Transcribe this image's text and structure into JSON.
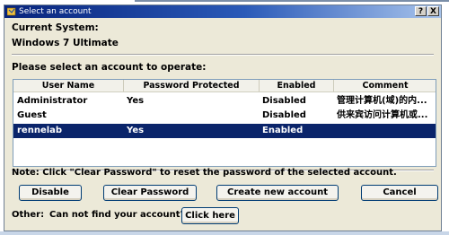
{
  "window": {
    "title": "Select an account",
    "help_btn": "?",
    "close_btn": "X"
  },
  "system": {
    "label": "Current System:",
    "value": "Windows 7 Ultimate"
  },
  "prompt": "Please select an account to operate:",
  "table": {
    "headers": [
      "User Name",
      "Password Protected",
      "Enabled",
      "Comment"
    ],
    "rows": [
      {
        "user": "Administrator",
        "protected": "Yes",
        "enabled": "Disabled",
        "comment": "管理计算机(域)的内..."
      },
      {
        "user": "Guest",
        "protected": "",
        "enabled": "Disabled",
        "comment": "供来宾访问计算机或..."
      },
      {
        "user": "rennelab",
        "protected": "Yes",
        "enabled": "Enabled",
        "comment": ""
      }
    ],
    "selected_row": 2
  },
  "note": "Note: Click \"Clear Password\" to reset the password of the selected account.",
  "buttons": {
    "disable": "Disable",
    "clear_password": "Clear Password",
    "create_new_account": "Create new account",
    "cancel": "Cancel"
  },
  "other": {
    "label": "Other:",
    "question": "Can not find your account?",
    "click_here": "Click here"
  },
  "colors": {
    "selection": "#0a246a",
    "dialog_bg": "#ece9d8",
    "title_bar": "#08247c"
  }
}
